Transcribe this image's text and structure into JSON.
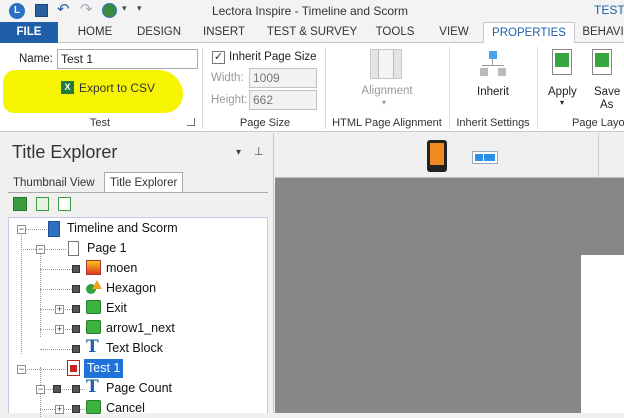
{
  "window": {
    "title": "Lectora Inspire - Timeline and Scorm",
    "user_label": "TEST"
  },
  "tabs": [
    {
      "label": "FILE"
    },
    {
      "label": "HOME"
    },
    {
      "label": "DESIGN"
    },
    {
      "label": "INSERT"
    },
    {
      "label": "TEST & SURVEY"
    },
    {
      "label": "TOOLS"
    },
    {
      "label": "VIEW"
    },
    {
      "label": "PROPERTIES"
    },
    {
      "label": "BEHAVI"
    }
  ],
  "ribbon": {
    "name_label": "Name:",
    "name_value": "Test 1",
    "export_label": "Export to CSV",
    "test_group": "Test",
    "inherit_page_size_label": "Inherit Page Size",
    "width_label": "Width:",
    "width_value": "1009",
    "height_label": "Height:",
    "height_value": "662",
    "page_size_group": "Page Size",
    "alignment_label": "Alignment",
    "html_alignment_group": "HTML Page Alignment",
    "inherit_label": "Inherit",
    "inherit_settings_group": "Inherit Settings",
    "apply_label": "Apply",
    "save_as_label_1": "Save",
    "save_as_label_2": "As",
    "page_layout_group": "Page Layo"
  },
  "explorer": {
    "title": "Title Explorer",
    "pin_glyph": "▾  ⊥",
    "tab_thumbnail": "Thumbnail View",
    "tab_title_explorer": "Title Explorer",
    "tree": [
      {
        "label": "Timeline and Scorm"
      },
      {
        "label": "Page 1"
      },
      {
        "label": "moen"
      },
      {
        "label": "Hexagon"
      },
      {
        "label": "Exit"
      },
      {
        "label": "arrow1_next"
      },
      {
        "label": "Text Block"
      },
      {
        "label": "Test 1"
      },
      {
        "label": "Page Count"
      },
      {
        "label": "Cancel"
      }
    ]
  },
  "colors": {
    "accent": "#1e5fa8",
    "highlight": "#f6f400",
    "selection": "#1e72d9"
  }
}
